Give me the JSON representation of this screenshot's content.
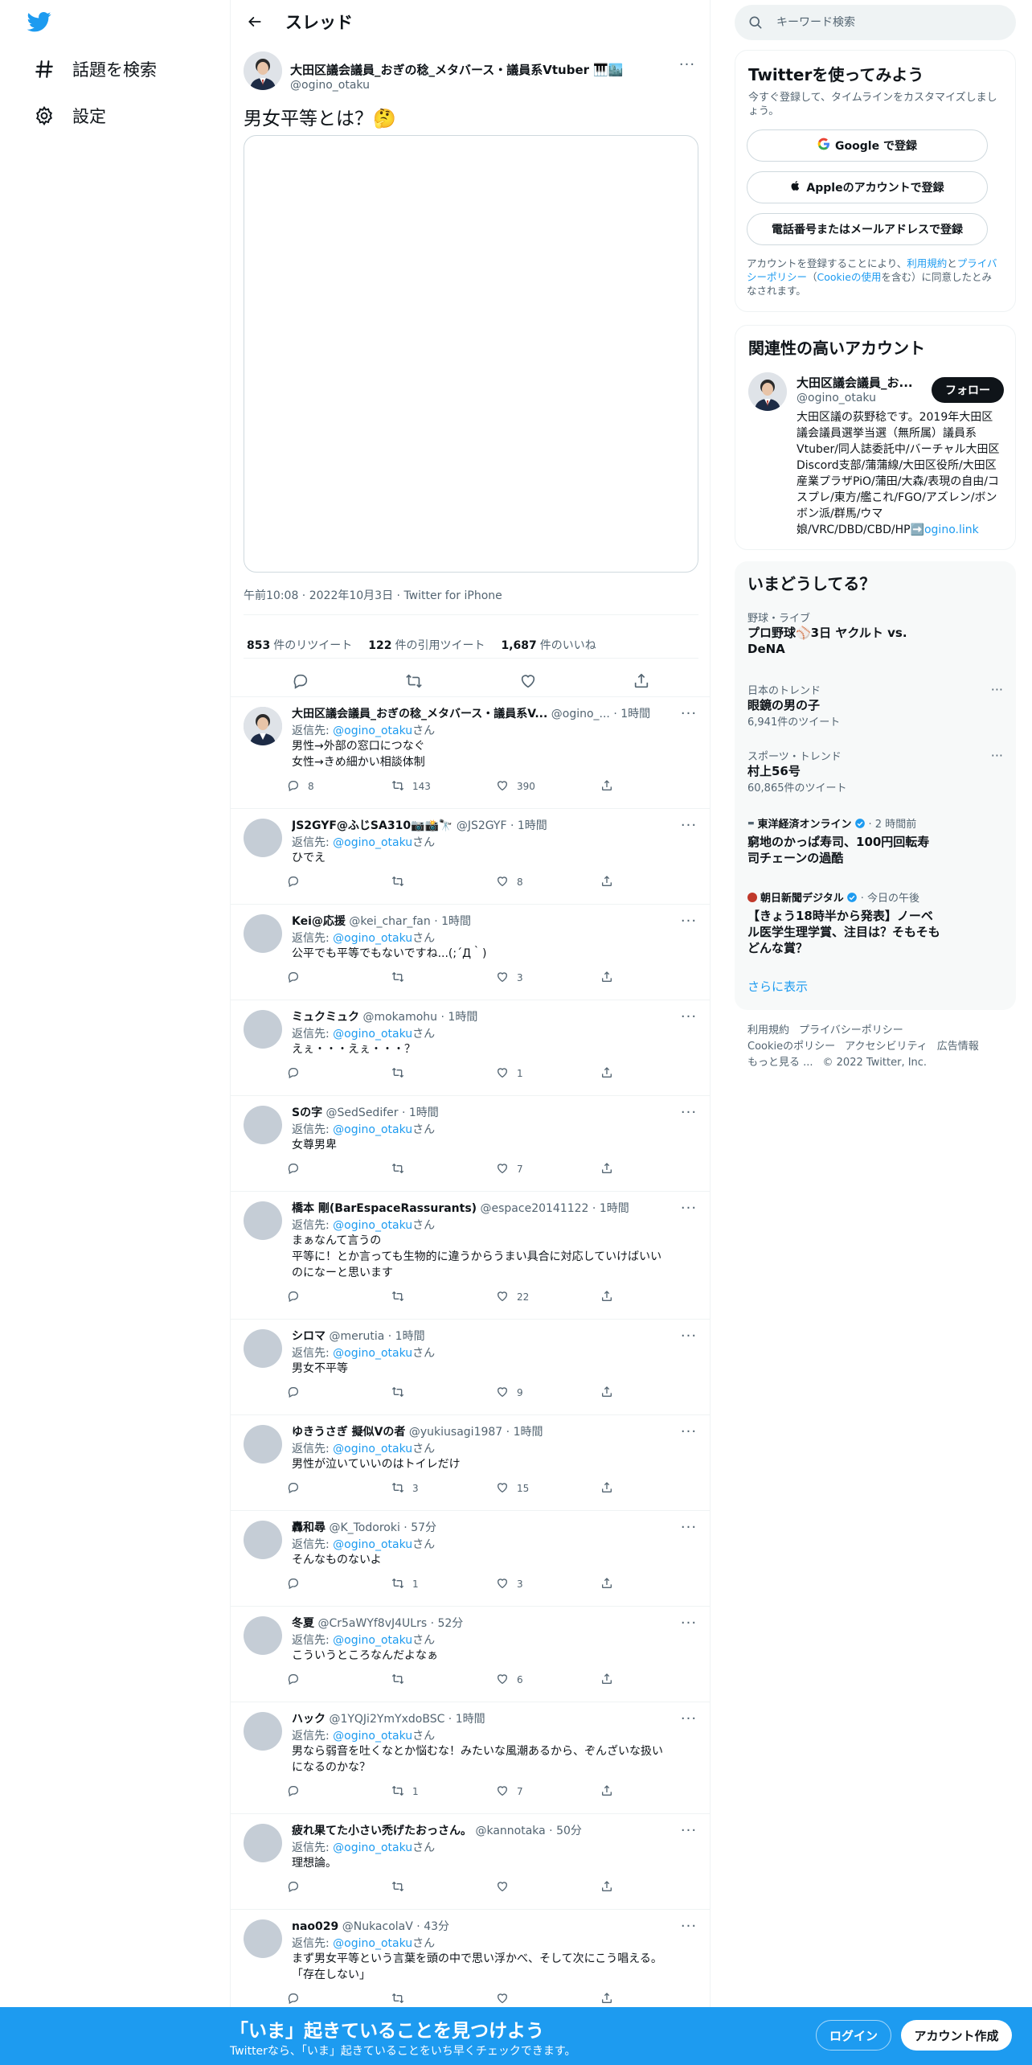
{
  "nav": {
    "explore_label": "話題を検索",
    "settings_label": "設定"
  },
  "header": {
    "title": "スレッド"
  },
  "main_tweet": {
    "author_name": "大田区議会議員_おぎの稔_メタバース・議員系Vtuber",
    "author_handle": "@ogino_otaku",
    "text": "男女平等とは？🤔",
    "time": "午前10:08",
    "date": "2022年10月3日",
    "client": "Twitter for iPhone",
    "retweets": "853",
    "retweets_label": "件のリツイート",
    "quotes": "122",
    "quotes_label": "件の引用ツイート",
    "likes": "1,687",
    "likes_label": "件のいいね"
  },
  "replies": [
    {
      "name": "大田区議会議員_おぎの稔_メタバース・議員系V...",
      "handle": "@ogino_...",
      "time": "1時間",
      "reply_prefix": "返信先: ",
      "reply_to": "@ogino_otaku",
      "reply_suffix": "さん",
      "lines": [
        "男性→外部の窓口につなぐ",
        "女性→きめ細かい相談体制"
      ],
      "reply_count": "8",
      "retweet_count": "143",
      "like_count": "390"
    },
    {
      "name": "JS2GYF@ふじSA310📷📸🔭",
      "handle": "@JS2GYF",
      "time": "1時間",
      "reply_prefix": "返信先: ",
      "reply_to": "@ogino_otaku",
      "reply_suffix": "さん",
      "lines": [
        "ひでえ"
      ],
      "reply_count": "",
      "retweet_count": "",
      "like_count": "8"
    },
    {
      "name": "Kei@応援",
      "handle": "@kei_char_fan",
      "time": "1時間",
      "reply_prefix": "返信先: ",
      "reply_to": "@ogino_otaku",
      "reply_suffix": "さん",
      "lines": [
        "公平でも平等でもないですね...(;´Д｀)"
      ],
      "reply_count": "",
      "retweet_count": "",
      "like_count": "3"
    },
    {
      "name": "ミュクミュク",
      "handle": "@mokamohu",
      "time": "1時間",
      "reply_prefix": "返信先: ",
      "reply_to": "@ogino_otaku",
      "reply_suffix": "さん",
      "lines": [
        "えぇ・・・えぇ・・・？"
      ],
      "reply_count": "",
      "retweet_count": "",
      "like_count": "1"
    },
    {
      "name": "Sの字",
      "handle": "@SedSedifer",
      "time": "1時間",
      "reply_prefix": "返信先: ",
      "reply_to": "@ogino_otaku",
      "reply_suffix": "さん",
      "lines": [
        "女尊男卑"
      ],
      "reply_count": "",
      "retweet_count": "",
      "like_count": "7"
    },
    {
      "name": "橋本 剛(BarEspaceRassurants)",
      "handle": "@espace20141122",
      "time": "1時間",
      "reply_prefix": "返信先: ",
      "reply_to": "@ogino_otaku",
      "reply_suffix": "さん",
      "lines": [
        "まぁなんて言うの",
        "平等に！とか言っても生物的に違うからうまい具合に対応していけばいい",
        "のになーと思います"
      ],
      "reply_count": "",
      "retweet_count": "",
      "like_count": "22"
    },
    {
      "name": "シロマ",
      "handle": "@merutia",
      "time": "1時間",
      "reply_prefix": "返信先: ",
      "reply_to": "@ogino_otaku",
      "reply_suffix": "さん",
      "lines": [
        "男女不平等"
      ],
      "reply_count": "",
      "retweet_count": "",
      "like_count": "9"
    },
    {
      "name": "ゆきうさぎ 擬似Vの者",
      "handle": "@yukiusagi1987",
      "time": "1時間",
      "reply_prefix": "返信先: ",
      "reply_to": "@ogino_otaku",
      "reply_suffix": "さん",
      "lines": [
        "男性が泣いていいのはトイレだけ"
      ],
      "reply_count": "",
      "retweet_count": "3",
      "like_count": "15"
    },
    {
      "name": "轟和尋",
      "handle": "@K_Todoroki",
      "time": "57分",
      "reply_prefix": "返信先: ",
      "reply_to": "@ogino_otaku",
      "reply_suffix": "さん",
      "lines": [
        "そんなものないよ"
      ],
      "reply_count": "",
      "retweet_count": "1",
      "like_count": "3"
    },
    {
      "name": "冬夏",
      "handle": "@Cr5aWYf8vJ4ULrs",
      "time": "52分",
      "reply_prefix": "返信先: ",
      "reply_to": "@ogino_otaku",
      "reply_suffix": "さん",
      "lines": [
        "こういうところなんだよなぁ"
      ],
      "reply_count": "",
      "retweet_count": "",
      "like_count": "6"
    },
    {
      "name": "ハック",
      "handle": "@1YQJi2YmYxdoBSC",
      "time": "1時間",
      "reply_prefix": "返信先: ",
      "reply_to": "@ogino_otaku",
      "reply_suffix": "さん",
      "lines": [
        "男なら弱音を吐くなとか悩むな！みたいな風潮あるから、ぞんざいな扱い",
        "になるのかな？"
      ],
      "reply_count": "",
      "retweet_count": "1",
      "like_count": "7"
    },
    {
      "name": "疲れ果てた小さい禿げたおっさん。",
      "handle": "@kannotaka",
      "time": "50分",
      "reply_prefix": "返信先: ",
      "reply_to": "@ogino_otaku",
      "reply_suffix": "さん",
      "lines": [
        "理想論。"
      ],
      "reply_count": "",
      "retweet_count": "",
      "like_count": ""
    },
    {
      "name": "nao029",
      "handle": "@NukacolaV",
      "time": "43分",
      "reply_prefix": "返信先: ",
      "reply_to": "@ogino_otaku",
      "reply_suffix": "さん",
      "lines": [
        "まず男女平等という言葉を頭の中で思い浮かべ、そして次にこう唱える。",
        "「存在しない」"
      ],
      "reply_count": "",
      "retweet_count": "",
      "like_count": ""
    }
  ],
  "sidebar": {
    "search_placeholder": "キーワード検索",
    "signup": {
      "title": "Twitterを使ってみよう",
      "subtitle": "今すぐ登録して、タイムラインをカスタマイズしましょう。",
      "google_label": "Google で登録",
      "apple_label": "Appleのアカウントで登録",
      "phone_label": "電話番号またはメールアドレスで登録",
      "terms_prefix": "アカウントを登録することにより、",
      "terms_link": "利用規約",
      "terms_and": "と",
      "privacy_link": "プライバシーポリシー",
      "terms_open": "（",
      "cookie_link": "Cookieの使用",
      "terms_suffix": "を含む）に同意したとみなされます。"
    },
    "related": {
      "title": "関連性の高いアカウント",
      "name": "大田区議会議員_お...",
      "handle": "@ogino_otaku",
      "follow_label": "フォロー",
      "bio": "大田区議の荻野稔です。2019年大田区議会議員選挙当選（無所属）議員系Vtuber/同人誌委託中/バーチャル大田区Discord支部/蒲蒲線/大田区役所/大田区産業プラザPiO/蒲田/大森/表現の自由/コスプレ/東方/艦これ/FGO/アズレン/ボンボン派/群馬/ウマ娘/VRC/DBD/CBD/HP➡️",
      "bio_link": "ogino.link"
    },
    "trends": {
      "title": "いまどうしてる？",
      "items": [
        {
          "category": "野球・ライブ",
          "title": "プロ野球⚾3日 ヤクルト vs. DeNA",
          "count": ""
        },
        {
          "category": "日本のトレンド",
          "title": "眼鏡の男の子",
          "count": "6,941件のツイート"
        },
        {
          "category": "スポーツ・トレンド",
          "title": "村上56号",
          "count": "60,865件のツイート"
        }
      ],
      "news": [
        {
          "source": "東洋経済オンライン",
          "time": "2 時間前",
          "title": "窮地のかっぱ寿司、100円回転寿司チェーンの過酷"
        },
        {
          "source": "朝日新聞デジタル",
          "time": "今日の午後",
          "title": "【きょう18時半から発表】ノーベル医学生理学賞、注目は？そもそもどんな賞？"
        }
      ],
      "show_more": "さらに表示"
    },
    "footer": {
      "links": [
        "利用規約",
        "プライバシーポリシー",
        "Cookieのポリシー",
        "アクセシビリティ",
        "広告情報",
        "もっと見る ..."
      ],
      "copyright": "© 2022 Twitter, Inc."
    }
  },
  "bottom_bar": {
    "title": "「いま」起きていることを見つけよう",
    "subtitle": "Twitterなら、「いま」起きていることをいち早くチェックできます。",
    "login_label": "ログイン",
    "signup_label": "アカウント作成"
  },
  "colors": {
    "accent": "#1d9bf0",
    "text": "#0f1419",
    "muted": "#536471",
    "border": "#eff3f4"
  }
}
